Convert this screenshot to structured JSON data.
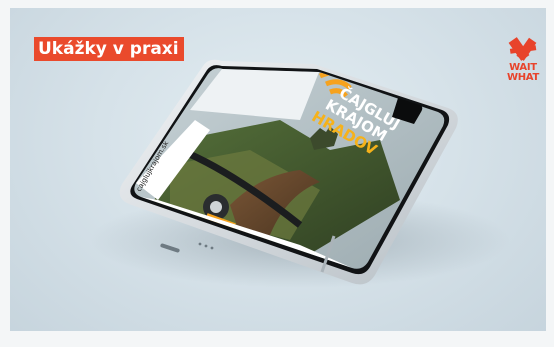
{
  "slide": {
    "title": "Ukážky v praxi",
    "brand": {
      "line1": "WAIT",
      "line2": "WHAT",
      "color": "#e8432b"
    }
  },
  "phone": {
    "headline": [
      "ČAJGLUJ",
      "KRAJOM",
      "HRADOV"
    ],
    "headline_colors": [
      "#ffffff",
      "#ffffff",
      "#f6b21a"
    ],
    "website": "cajglujkrajom.sk",
    "accent": "#f6a21e"
  },
  "icons": [
    "logo-mark-icon",
    "wifi-signal-icon",
    "bike-handlebar-icon",
    "sponsor-logo-icon"
  ]
}
